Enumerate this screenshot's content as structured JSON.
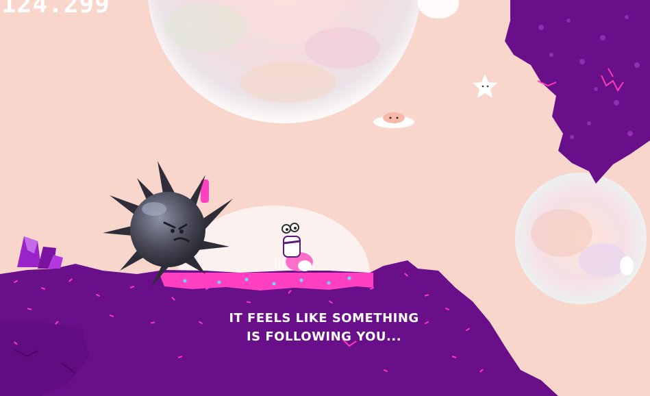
{
  "hud": {
    "score": "124.299"
  },
  "narration": {
    "line1": "IT FEELS LIKE SOMETHING",
    "line2": "IS FOLLOWING YOU..."
  },
  "colors": {
    "sky": "#f9d6cc",
    "ground_purple": "#6a0f8a",
    "ground_speckle": "#ff3ab8",
    "goo_pink": "#ff40c0",
    "spike_ball": "#3b3a46",
    "bubble": "#fbefe8"
  },
  "entities": {
    "enemy": "spiked-ball-icon",
    "player": "player-character-icon",
    "collectible": "star-icon",
    "floater": "cloud-creature-icon",
    "decoration": "crystal-icon"
  }
}
